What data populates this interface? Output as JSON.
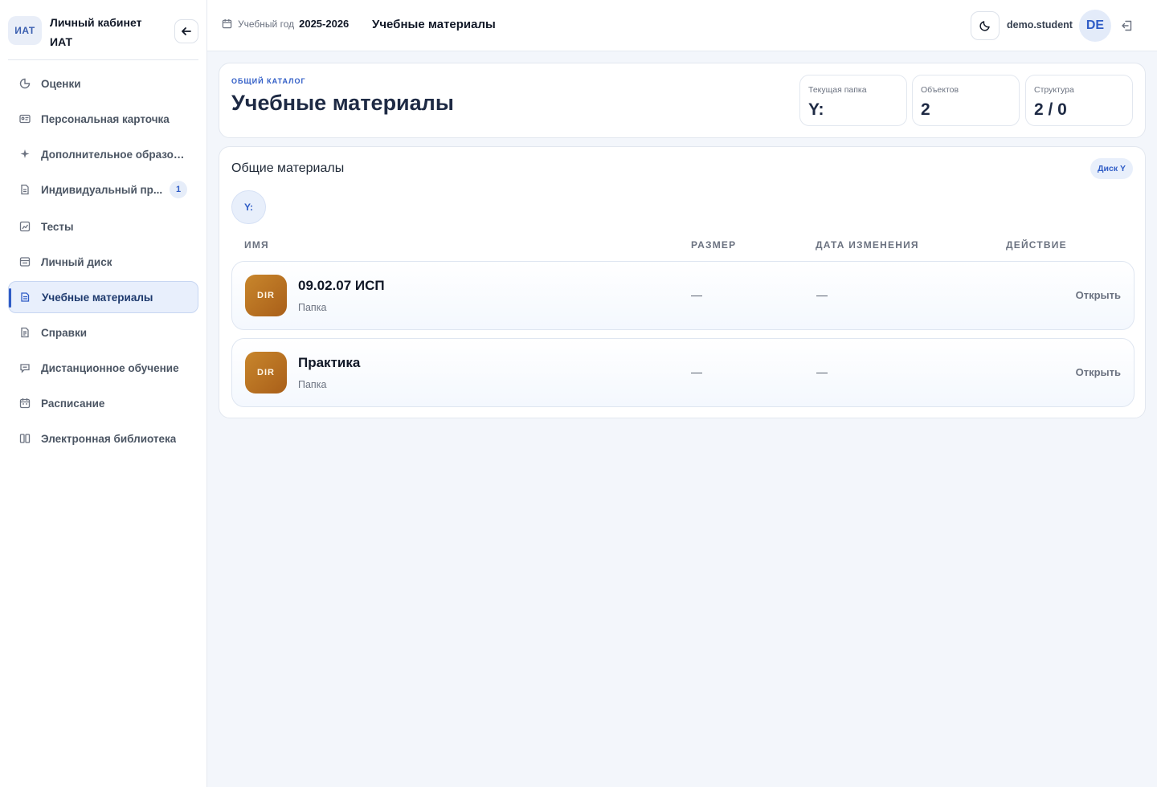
{
  "brand": {
    "logo": "ИАТ",
    "title": "Личный кабинет ИАТ"
  },
  "nav": {
    "items": [
      {
        "label": "Оценки",
        "icon": "pie-chart-icon"
      },
      {
        "label": "Персональная карточка",
        "icon": "id-card-icon"
      },
      {
        "label": "Дополнительное образов...",
        "icon": "sparkle-icon"
      },
      {
        "label": "Индивидуальный пр...",
        "icon": "document-icon",
        "badge": "1"
      },
      {
        "label": "Тесты",
        "icon": "chart-box-icon"
      },
      {
        "label": "Личный диск",
        "icon": "drive-icon"
      },
      {
        "label": "Учебные материалы",
        "icon": "folder-doc-icon",
        "active": true
      },
      {
        "label": "Справки",
        "icon": "file-icon"
      },
      {
        "label": "Дистанционное обучение",
        "icon": "chat-icon"
      },
      {
        "label": "Расписание",
        "icon": "calendar-icon"
      },
      {
        "label": "Электронная библиотека",
        "icon": "book-icon"
      }
    ]
  },
  "topbar": {
    "year_label": "Учебный год",
    "year_value": "2025-2026",
    "title": "Учебные материалы",
    "username": "demo.student",
    "avatar": "DE"
  },
  "hero": {
    "eyebrow": "ОБЩИЙ КАТАЛОГ",
    "title": "Учебные материалы",
    "stats": [
      {
        "label": "Текущая папка",
        "value": "Y:"
      },
      {
        "label": "Объектов",
        "value": "2"
      },
      {
        "label": "Структура",
        "value": "2 / 0"
      }
    ]
  },
  "materials": {
    "title": "Общие материалы",
    "disk_chip": "Диск Y",
    "crumb": "Y:",
    "columns": [
      "Имя",
      "Размер",
      "Дата изменения",
      "Действие"
    ],
    "rows": [
      {
        "badge": "DIR",
        "name": "09.02.07 ИСП",
        "type": "Папка",
        "size": "—",
        "date": "—",
        "action": "Открыть"
      },
      {
        "badge": "DIR",
        "name": "Практика",
        "type": "Папка",
        "size": "—",
        "date": "—",
        "action": "Открыть"
      }
    ]
  },
  "colors": {
    "accent": "#2f5cc6",
    "folder": "#b8732a",
    "background": "#f3f6fb"
  }
}
